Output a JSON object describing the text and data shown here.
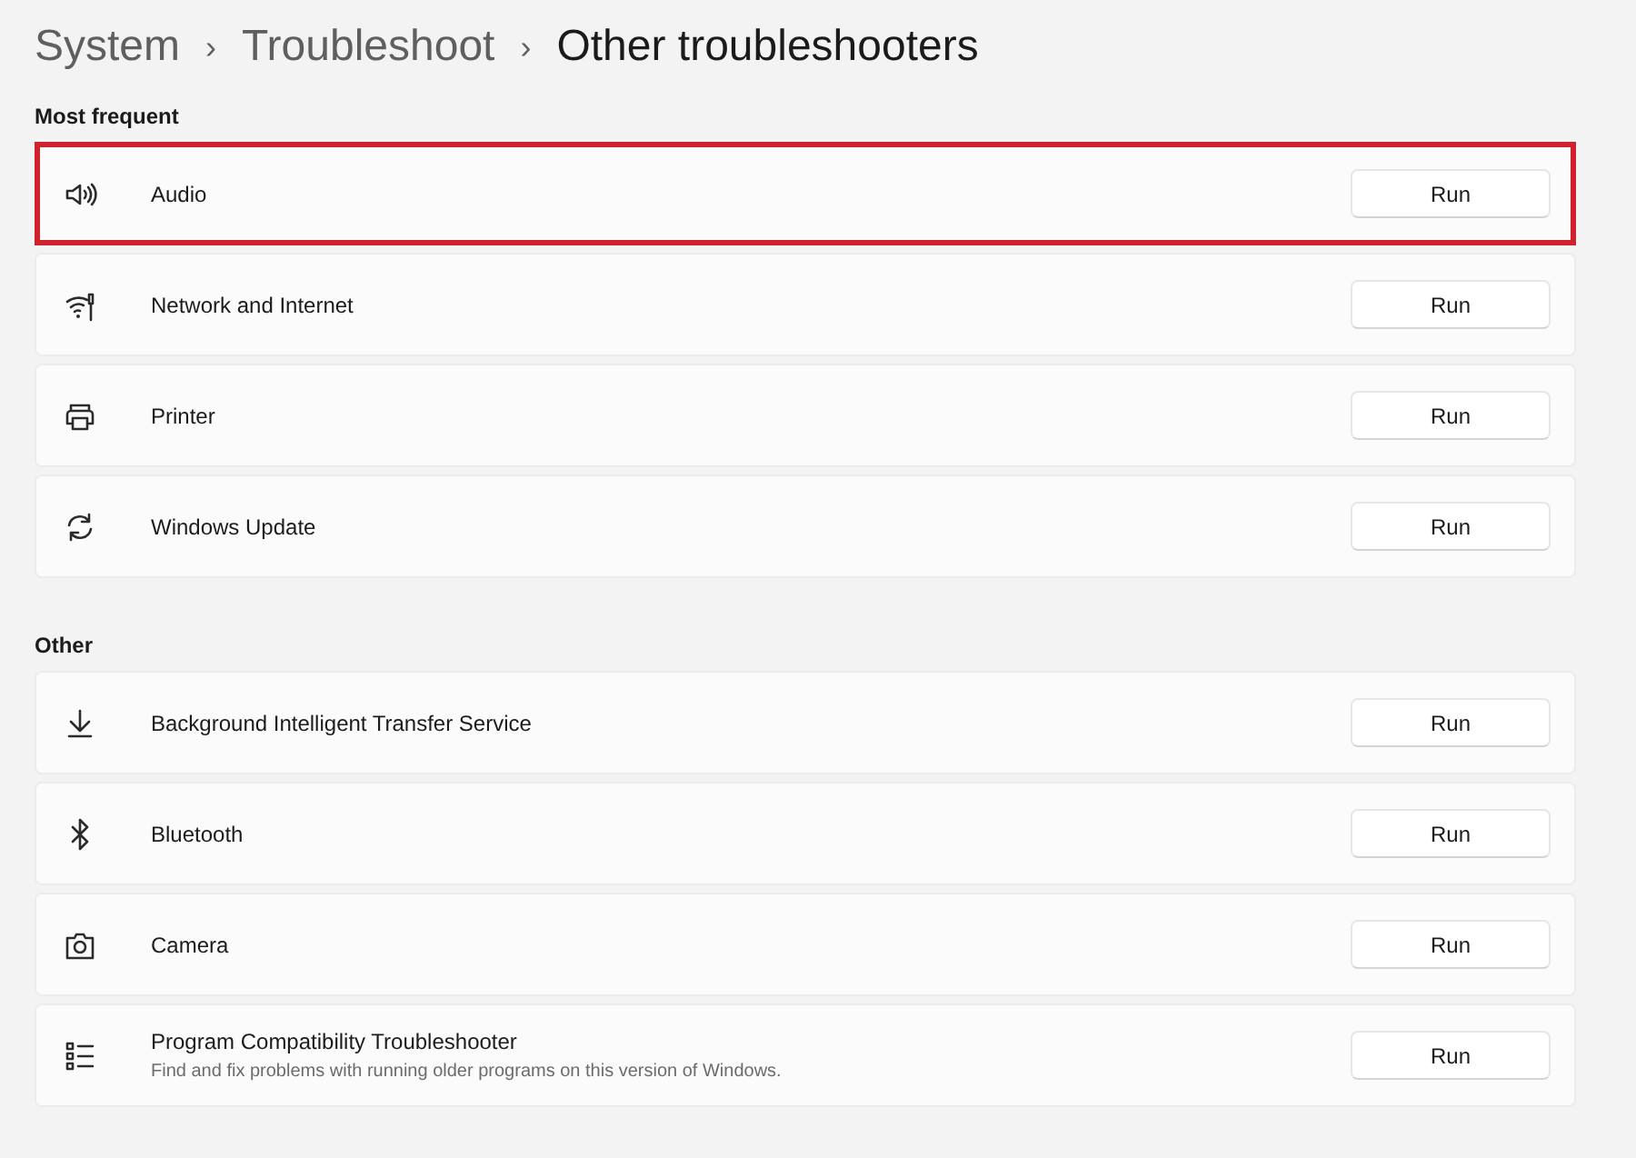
{
  "breadcrumb": [
    {
      "label": "System",
      "current": false
    },
    {
      "label": "Troubleshoot",
      "current": false
    },
    {
      "label": "Other troubleshooters",
      "current": true
    }
  ],
  "separator": "›",
  "sections": [
    {
      "heading": "Most frequent",
      "items": [
        {
          "kind": "audio",
          "title": "Audio",
          "button": "Run",
          "highlighted": true
        },
        {
          "kind": "network",
          "title": "Network and Internet",
          "button": "Run",
          "highlighted": false
        },
        {
          "kind": "printer",
          "title": "Printer",
          "button": "Run",
          "highlighted": false
        },
        {
          "kind": "update",
          "title": "Windows Update",
          "button": "Run",
          "highlighted": false
        }
      ]
    },
    {
      "heading": "Other",
      "items": [
        {
          "kind": "download",
          "title": "Background Intelligent Transfer Service",
          "button": "Run",
          "highlighted": false
        },
        {
          "kind": "bluetooth",
          "title": "Bluetooth",
          "button": "Run",
          "highlighted": false
        },
        {
          "kind": "camera",
          "title": "Camera",
          "button": "Run",
          "highlighted": false
        },
        {
          "kind": "list",
          "title": "Program Compatibility Troubleshooter",
          "description": "Find and fix problems with running older programs on this version of Windows.",
          "button": "Run",
          "highlighted": false
        }
      ]
    }
  ]
}
